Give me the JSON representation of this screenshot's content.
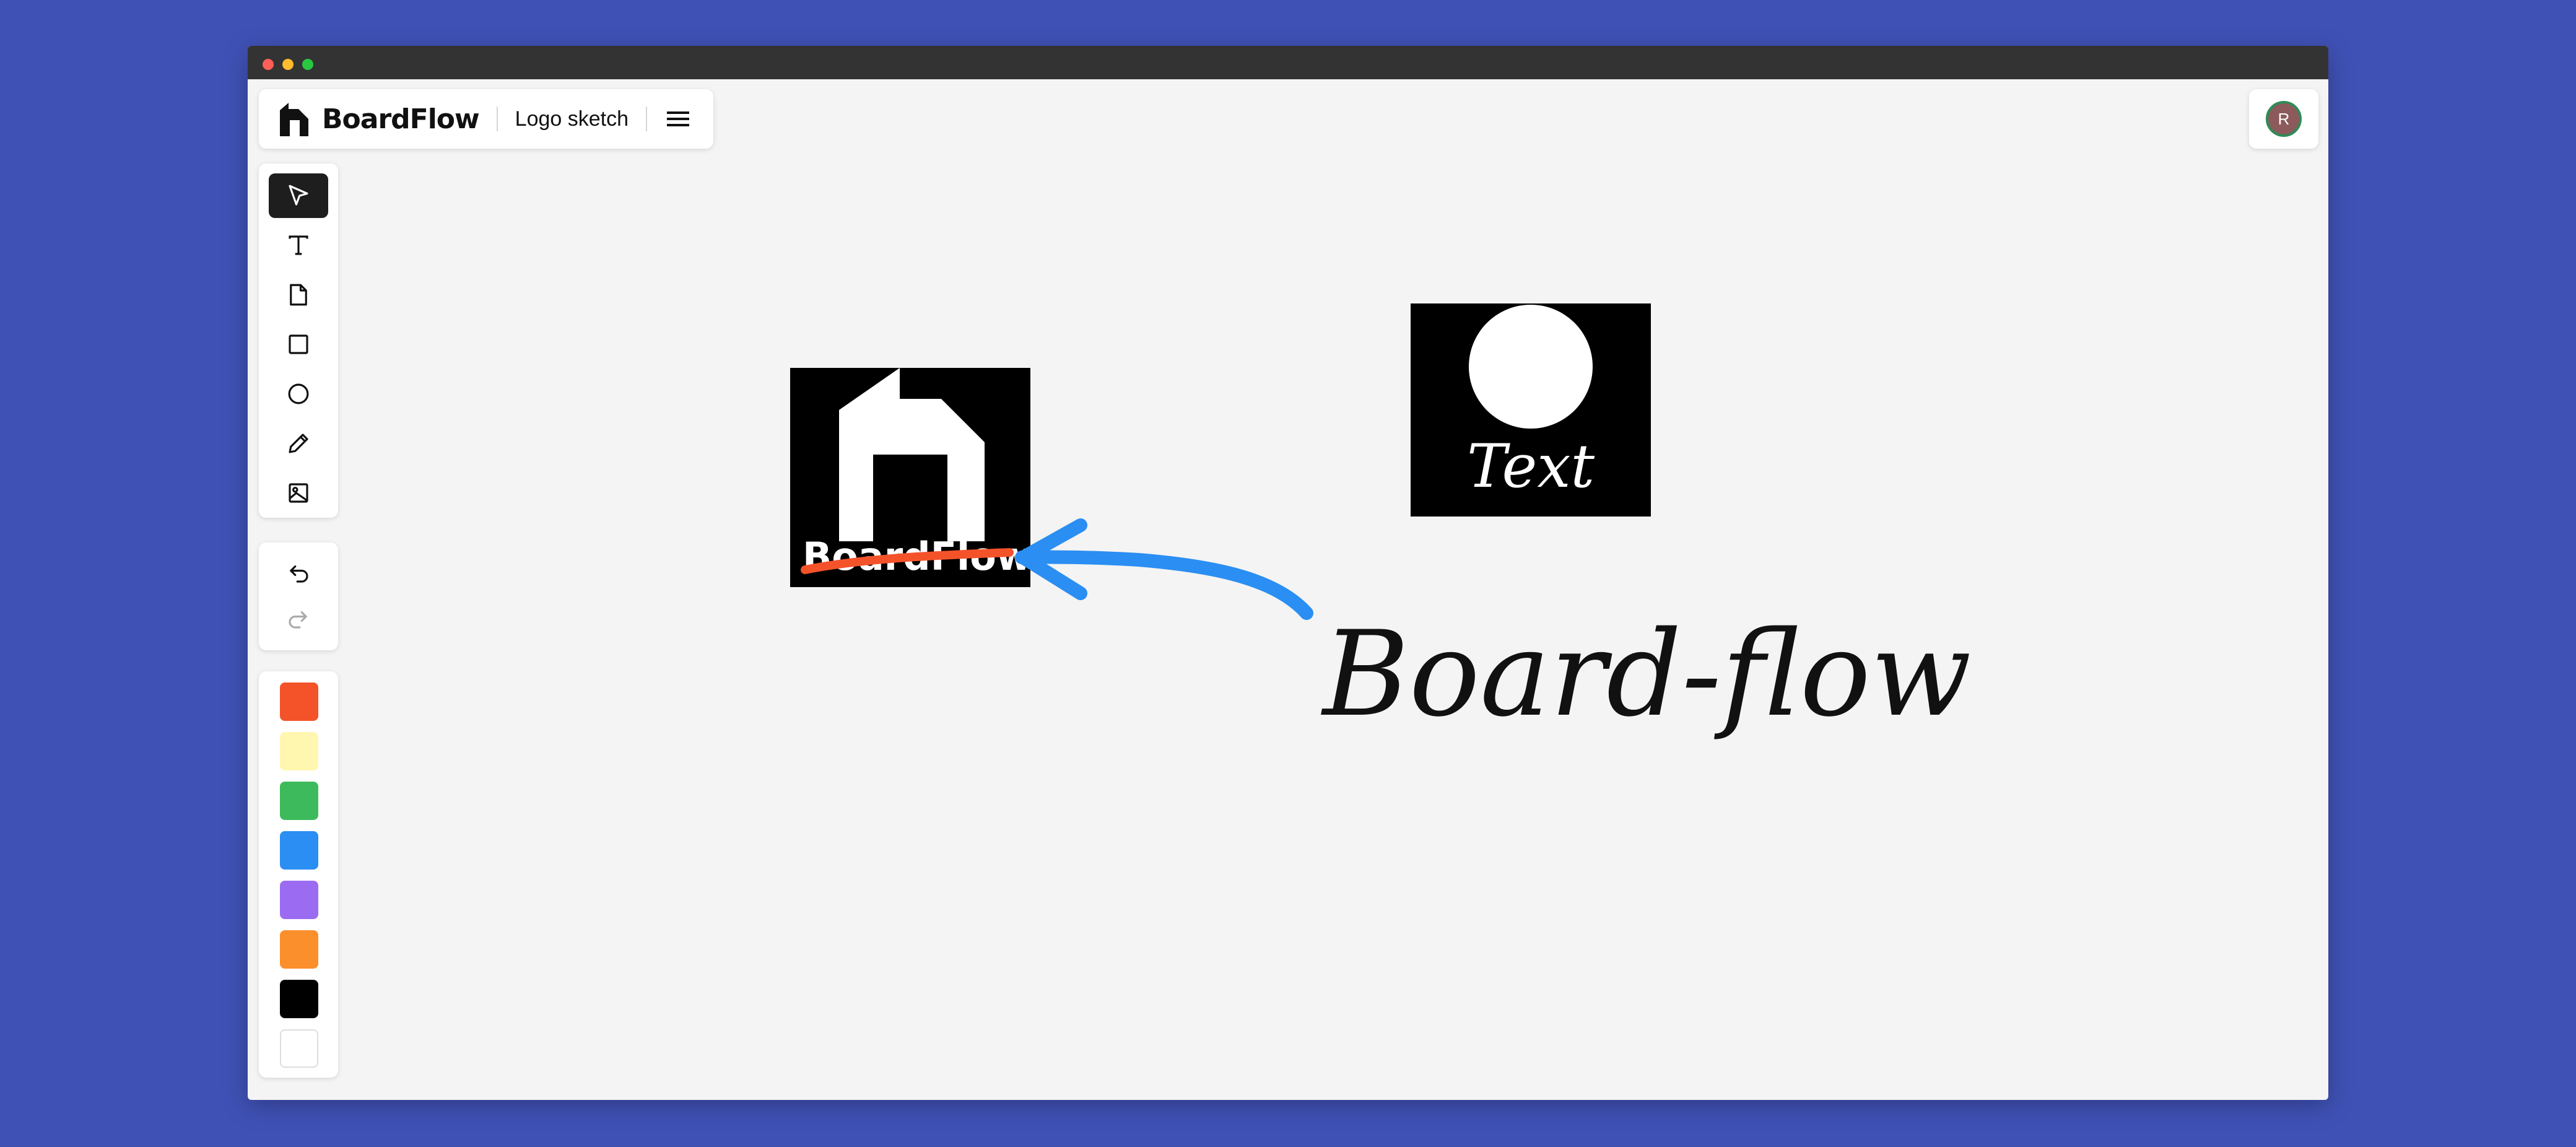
{
  "app": {
    "name": "BoardFlow",
    "document_title": "Logo sketch"
  },
  "user": {
    "avatar_initial": "R"
  },
  "tools": [
    {
      "name": "select-tool",
      "icon": "pointer-icon",
      "active": true
    },
    {
      "name": "text-tool",
      "icon": "text-icon",
      "active": false
    },
    {
      "name": "note-tool",
      "icon": "sticky-note-icon",
      "active": false
    },
    {
      "name": "rectangle-tool",
      "icon": "square-icon",
      "active": false
    },
    {
      "name": "ellipse-tool",
      "icon": "circle-icon",
      "active": false
    },
    {
      "name": "pencil-tool",
      "icon": "pencil-icon",
      "active": false
    },
    {
      "name": "image-tool",
      "icon": "image-icon",
      "active": false
    }
  ],
  "history": [
    {
      "name": "undo-button",
      "icon": "undo-icon",
      "enabled": true
    },
    {
      "name": "redo-button",
      "icon": "redo-icon",
      "enabled": false
    }
  ],
  "colors": [
    "#f4532a",
    "#fff7b0",
    "#3dbb5c",
    "#2b8ef2",
    "#9b6cf2",
    "#fb8f2c",
    "#000000",
    "#ffffff"
  ],
  "canvas": {
    "logo_card_text": "BoardFlow",
    "placeholder_card_text": "Text",
    "handwritten_text": "Board-flow",
    "strike_color": "#f4532a",
    "arrow_color": "#2b8ef2"
  }
}
